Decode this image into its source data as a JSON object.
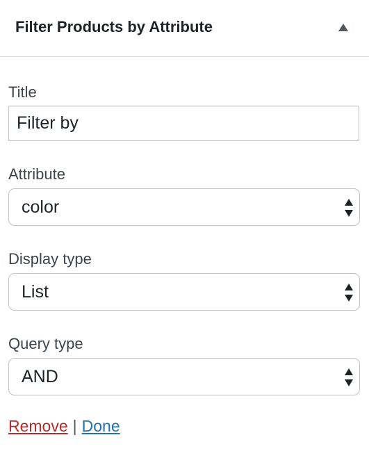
{
  "widget": {
    "title": "Filter Products by Attribute"
  },
  "fields": {
    "title": {
      "label": "Title",
      "value": "Filter by"
    },
    "attribute": {
      "label": "Attribute",
      "selected": "color"
    },
    "display_type": {
      "label": "Display type",
      "selected": "List"
    },
    "query_type": {
      "label": "Query type",
      "selected": "AND"
    }
  },
  "actions": {
    "remove_label": "Remove",
    "separator": "|",
    "done_label": "Done"
  },
  "icons": {
    "toggle": "triangle-up-icon",
    "select_arrows": "select-arrows-icon"
  },
  "colors": {
    "remove_link": "#b32d2e",
    "done_link": "#2271b1",
    "border": "#c3c4c7"
  }
}
